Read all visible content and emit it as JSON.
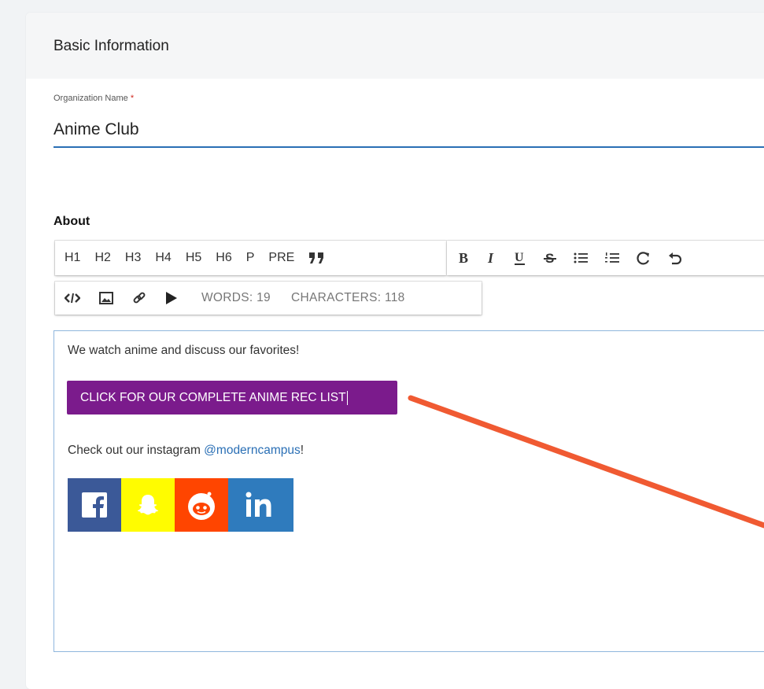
{
  "section": {
    "title": "Basic Information"
  },
  "org_name": {
    "label": "Organization Name",
    "required_mark": "*",
    "value": "Anime Club"
  },
  "about": {
    "label": "About"
  },
  "toolbar": {
    "blocks": [
      "H1",
      "H2",
      "H3",
      "H4",
      "H5",
      "H6",
      "P",
      "PRE"
    ],
    "icons": [
      "blockquote-icon",
      "bold-icon",
      "italic-icon",
      "underline-icon",
      "strikethrough-icon",
      "bulleted-list-icon",
      "numbered-list-icon",
      "redo-icon",
      "undo-icon",
      "code-icon",
      "image-icon",
      "link-icon",
      "video-icon"
    ],
    "words": "WORDS: 19",
    "characters": "CHARACTERS: 118"
  },
  "editor": {
    "line1": "We watch anime and discuss our favorites!",
    "button_label": "CLICK FOR OUR COMPLETE ANIME REC LIST",
    "line2_prefix": "Check out our instagram ",
    "line2_mention": "@moderncampus",
    "line2_suffix": "!",
    "socials": [
      "facebook-icon",
      "snapchat-icon",
      "reddit-icon",
      "linkedin-icon"
    ]
  },
  "colors": {
    "accent": "#2a6fb5",
    "cta_button": "#7b1b8c",
    "annotation_arrow": "#f05a32",
    "facebook": "#3b5998",
    "snapchat": "#fffc00",
    "reddit": "#ff4500",
    "linkedin": "#2f7bbd"
  }
}
